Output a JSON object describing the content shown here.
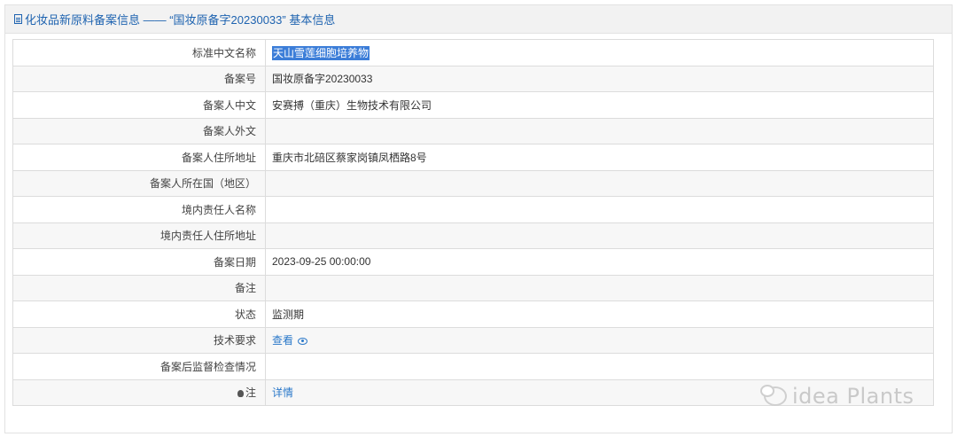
{
  "header": {
    "title": "化妆品新原料备案信息 —— “国妆原备字20230033” 基本信息",
    "icon": "document-icon"
  },
  "rows": [
    {
      "label": "标准中文名称",
      "value": "天山雪莲细胞培养物"
    },
    {
      "label": "备案号",
      "value": "国妆原备字20230033"
    },
    {
      "label": "备案人中文",
      "value": "安赛搏（重庆）生物技术有限公司"
    },
    {
      "label": "备案人外文",
      "value": ""
    },
    {
      "label": "备案人住所地址",
      "value": "重庆市北碚区蔡家岗镇凤栖路8号"
    },
    {
      "label": "备案人所在国（地区）",
      "value": ""
    },
    {
      "label": "境内责任人名称",
      "value": ""
    },
    {
      "label": "境内责任人住所地址",
      "value": ""
    },
    {
      "label": "备案日期",
      "value": "2023-09-25 00:00:00"
    },
    {
      "label": "备注",
      "value": ""
    },
    {
      "label": "状态",
      "value": "监测期"
    },
    {
      "label": "技术要求",
      "value": "查看"
    },
    {
      "label": "备案后监督检查情况",
      "value": ""
    },
    {
      "label": "注",
      "value": "详情"
    }
  ],
  "watermark": "idea Plants",
  "colors": {
    "link": "#2a78c9",
    "header_text": "#1e63b0",
    "selection": "#3b7dd8"
  }
}
